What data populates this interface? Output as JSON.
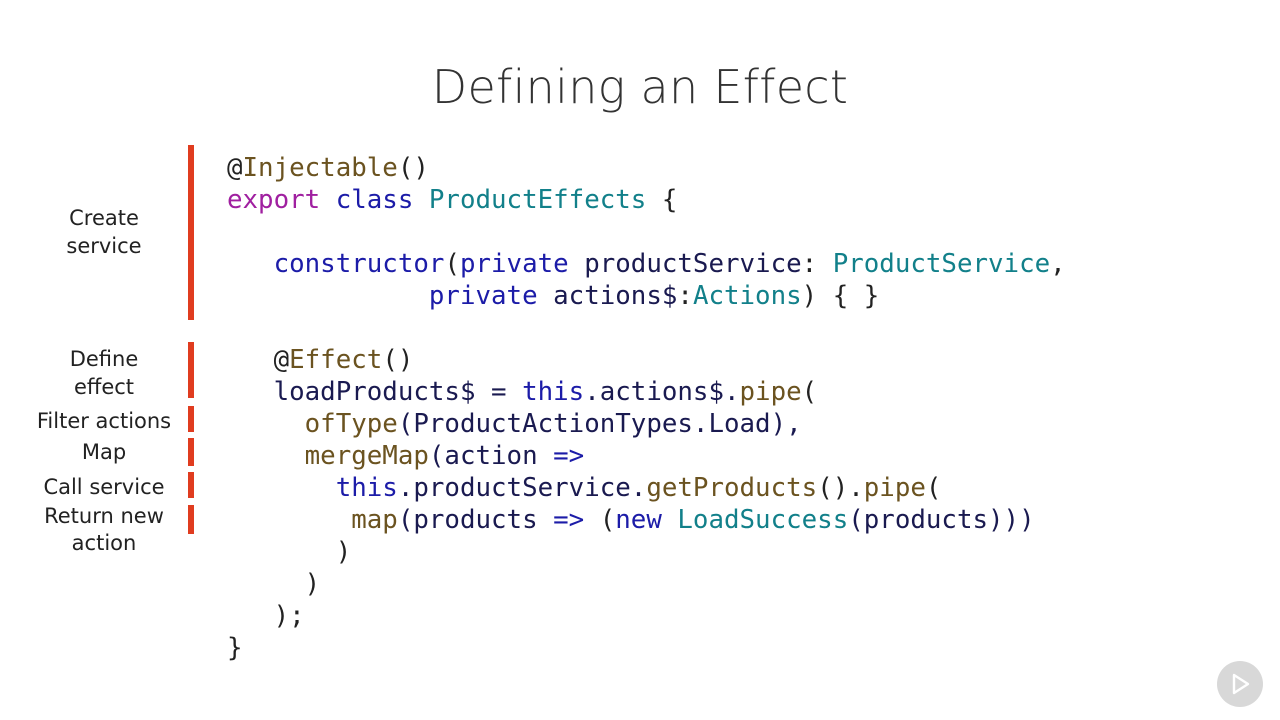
{
  "slide": {
    "title": "Defining an Effect"
  },
  "annotations": [
    {
      "name": "create-service",
      "lines": [
        "Create",
        "service"
      ]
    },
    {
      "name": "define-effect",
      "lines": [
        "Define",
        "effect"
      ]
    },
    {
      "name": "filter-actions",
      "lines": [
        "Filter actions"
      ]
    },
    {
      "name": "map",
      "lines": [
        "Map"
      ]
    },
    {
      "name": "call-service",
      "lines": [
        "Call service"
      ]
    },
    {
      "name": "return-new-action",
      "lines": [
        "Return new",
        "action"
      ]
    }
  ],
  "code_lines": [
    [
      {
        "t": "@",
        "c": "dec"
      },
      {
        "t": "Injectable",
        "c": "fn"
      },
      {
        "t": "()",
        "c": "punc"
      }
    ],
    [
      {
        "t": "export",
        "c": "kw"
      },
      {
        "t": " ",
        "c": "id"
      },
      {
        "t": "class",
        "c": "kw2"
      },
      {
        "t": " ",
        "c": "id"
      },
      {
        "t": "ProductEffects",
        "c": "type"
      },
      {
        "t": " {",
        "c": "punc"
      }
    ],
    [],
    [
      {
        "t": "   ",
        "c": "id"
      },
      {
        "t": "constructor",
        "c": "kw2"
      },
      {
        "t": "(",
        "c": "punc"
      },
      {
        "t": "private",
        "c": "kw2"
      },
      {
        "t": " productService",
        "c": "id"
      },
      {
        "t": ": ",
        "c": "punc"
      },
      {
        "t": "ProductService",
        "c": "type"
      },
      {
        "t": ",",
        "c": "punc"
      }
    ],
    [
      {
        "t": "             ",
        "c": "id"
      },
      {
        "t": "private",
        "c": "kw2"
      },
      {
        "t": " actions$",
        "c": "id"
      },
      {
        "t": ":",
        "c": "punc"
      },
      {
        "t": "Actions",
        "c": "type"
      },
      {
        "t": ") { }",
        "c": "punc"
      }
    ],
    [],
    [
      {
        "t": "   ",
        "c": "id"
      },
      {
        "t": "@",
        "c": "dec"
      },
      {
        "t": "Effect",
        "c": "fn"
      },
      {
        "t": "()",
        "c": "punc"
      }
    ],
    [
      {
        "t": "   ",
        "c": "id"
      },
      {
        "t": "loadProducts$",
        "c": "id"
      },
      {
        "t": " = ",
        "c": "op"
      },
      {
        "t": "this",
        "c": "kw2"
      },
      {
        "t": ".actions$.",
        "c": "id"
      },
      {
        "t": "pipe",
        "c": "fn"
      },
      {
        "t": "(",
        "c": "punc"
      }
    ],
    [
      {
        "t": "     ",
        "c": "id"
      },
      {
        "t": "ofType",
        "c": "fn"
      },
      {
        "t": "(ProductActionTypes.Load),",
        "c": "id"
      }
    ],
    [
      {
        "t": "     ",
        "c": "id"
      },
      {
        "t": "mergeMap",
        "c": "fn"
      },
      {
        "t": "(action ",
        "c": "id"
      },
      {
        "t": "=>",
        "c": "kw2"
      }
    ],
    [
      {
        "t": "       ",
        "c": "id"
      },
      {
        "t": "this",
        "c": "kw2"
      },
      {
        "t": ".productService.",
        "c": "id"
      },
      {
        "t": "getProducts",
        "c": "fn"
      },
      {
        "t": "().",
        "c": "punc"
      },
      {
        "t": "pipe",
        "c": "fn"
      },
      {
        "t": "(",
        "c": "punc"
      }
    ],
    [
      {
        "t": "        ",
        "c": "id"
      },
      {
        "t": "map",
        "c": "fn"
      },
      {
        "t": "(products ",
        "c": "id"
      },
      {
        "t": "=>",
        "c": "kw2"
      },
      {
        "t": " (",
        "c": "punc"
      },
      {
        "t": "new",
        "c": "kw2"
      },
      {
        "t": " ",
        "c": "id"
      },
      {
        "t": "LoadSuccess",
        "c": "type"
      },
      {
        "t": "(products)))",
        "c": "id"
      }
    ],
    [
      {
        "t": "       )",
        "c": "punc"
      }
    ],
    [
      {
        "t": "     )",
        "c": "punc"
      }
    ],
    [
      {
        "t": "   );",
        "c": "punc"
      }
    ],
    [
      {
        "t": "}",
        "c": "punc"
      }
    ]
  ],
  "icons": {
    "play": "play-icon"
  },
  "colors": {
    "accent_bar": "#e03c1f",
    "keyword_purple": "#a020a0",
    "keyword_blue": "#1c1ca8",
    "type_teal": "#12808a",
    "function_brown": "#6b5320"
  }
}
